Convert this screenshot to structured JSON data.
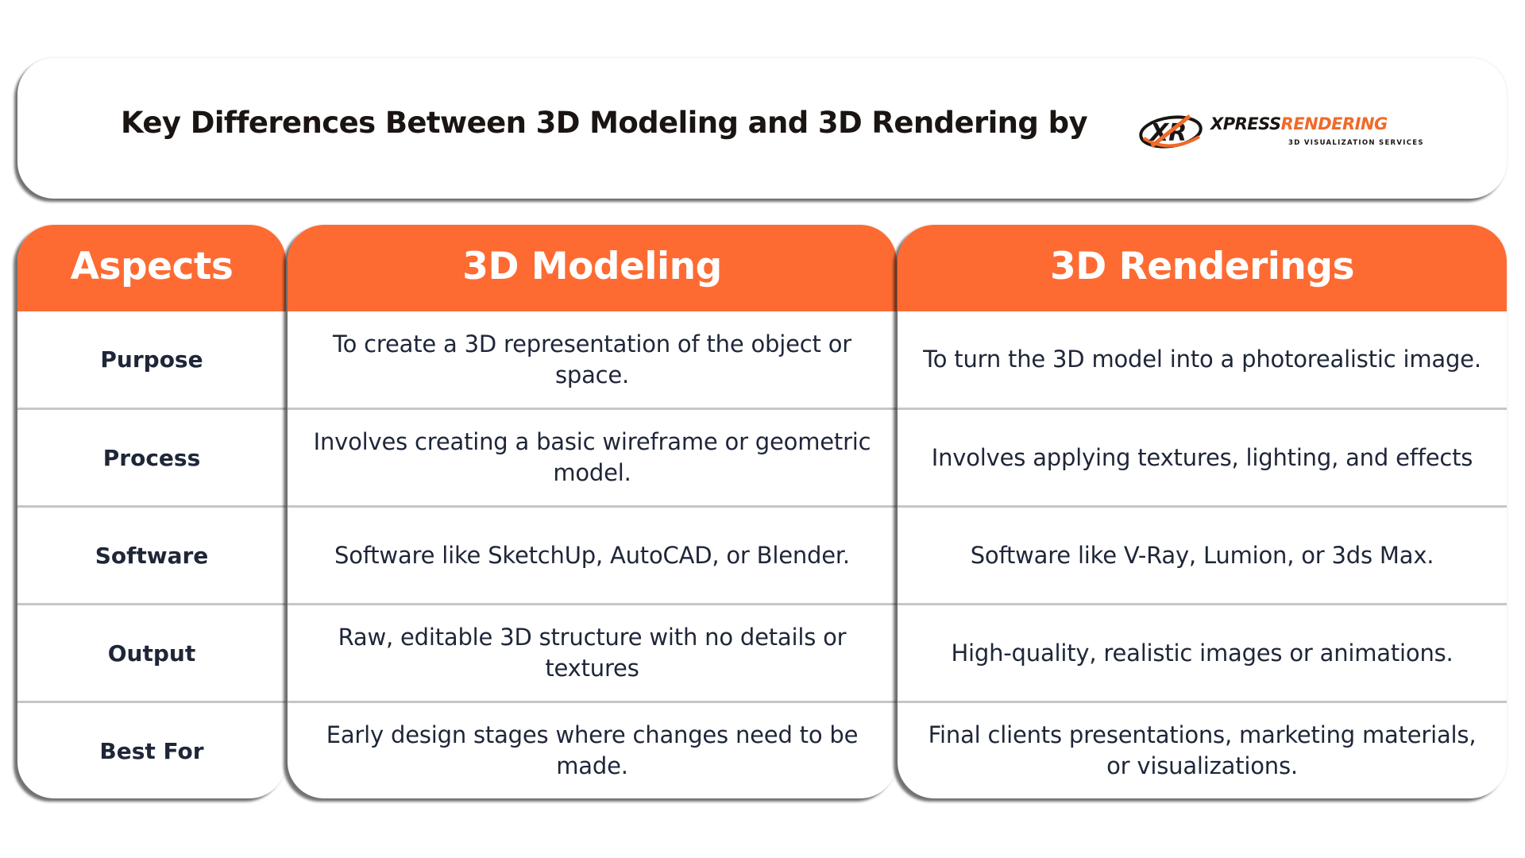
{
  "header": {
    "title": "Key Differences Between 3D Modeling and 3D Rendering by",
    "logo": {
      "icon": "xr-logo-icon",
      "word_dark": "XPRESS",
      "word_accent": "RENDERING",
      "tagline": "3D VISUALIZATION SERVICES"
    }
  },
  "colors": {
    "accent": "#fd6b33",
    "text": "#1e2638",
    "title": "#1a1412",
    "divider": "#c6c6c6"
  },
  "table": {
    "columns": [
      "Aspects",
      "3D Modeling",
      "3D Renderings"
    ],
    "rows": [
      {
        "aspect": "Purpose",
        "modeling": "To create a 3D representation of the object or space.",
        "rendering": "To turn the 3D model into a photorealistic image."
      },
      {
        "aspect": "Process",
        "modeling": "Involves creating a basic wireframe or geometric model.",
        "rendering": "Involves applying textures, lighting, and effects"
      },
      {
        "aspect": "Software",
        "modeling": "Software like SketchUp, AutoCAD, or Blender.",
        "rendering": "Software like V-Ray, Lumion, or 3ds Max."
      },
      {
        "aspect": "Output",
        "modeling": "Raw, editable 3D structure with no details or textures",
        "rendering": "High-quality, realistic images or animations."
      },
      {
        "aspect": "Best For",
        "modeling": "Early design stages where changes need to be made.",
        "rendering": "Final clients presentations, marketing materials, or visualizations."
      }
    ]
  }
}
